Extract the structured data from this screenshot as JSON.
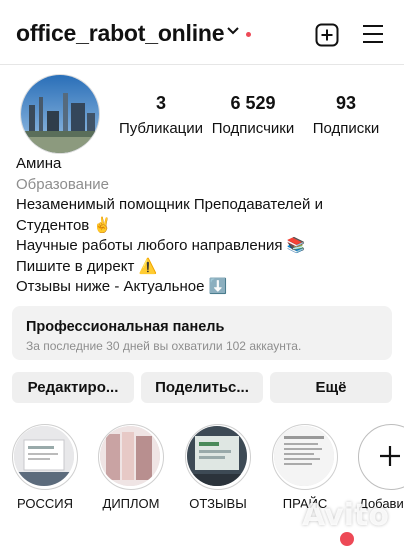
{
  "header": {
    "username": "office_rabot_online"
  },
  "profile": {
    "stats": [
      {
        "value": "3",
        "label": "Публикации"
      },
      {
        "value": "6 529",
        "label": "Подписчики"
      },
      {
        "value": "93",
        "label": "Подписки"
      }
    ],
    "name": "Амина",
    "category": "Образование",
    "bio_lines": [
      "Незаменимый помощник Преподавателей и",
      "Студентов ✌️",
      "Научные работы любого направления 📚",
      "Пишите в директ ⚠️",
      "Отзывы ниже - Актуальное ⬇️"
    ]
  },
  "dashboard": {
    "title": "Профессиональная панель",
    "subtitle": "За последние 30 дней вы охватили 102 аккаунта."
  },
  "buttons": {
    "edit": "Редактиро...",
    "share": "Поделитьс...",
    "more": "Ещё"
  },
  "highlights": [
    {
      "label": "РОССИЯ"
    },
    {
      "label": "ДИПЛОМ"
    },
    {
      "label": "ОТЗЫВЫ"
    },
    {
      "label": "ПРАЙС"
    },
    {
      "label": "Добави"
    }
  ],
  "watermark": "Avito",
  "icons": [
    "chevron-down-icon",
    "new-post-icon",
    "menu-icon",
    "plus-icon"
  ],
  "colors": {
    "notification": "#ed4956",
    "muted": "#8e8e8e",
    "button_bg": "#efefef"
  }
}
